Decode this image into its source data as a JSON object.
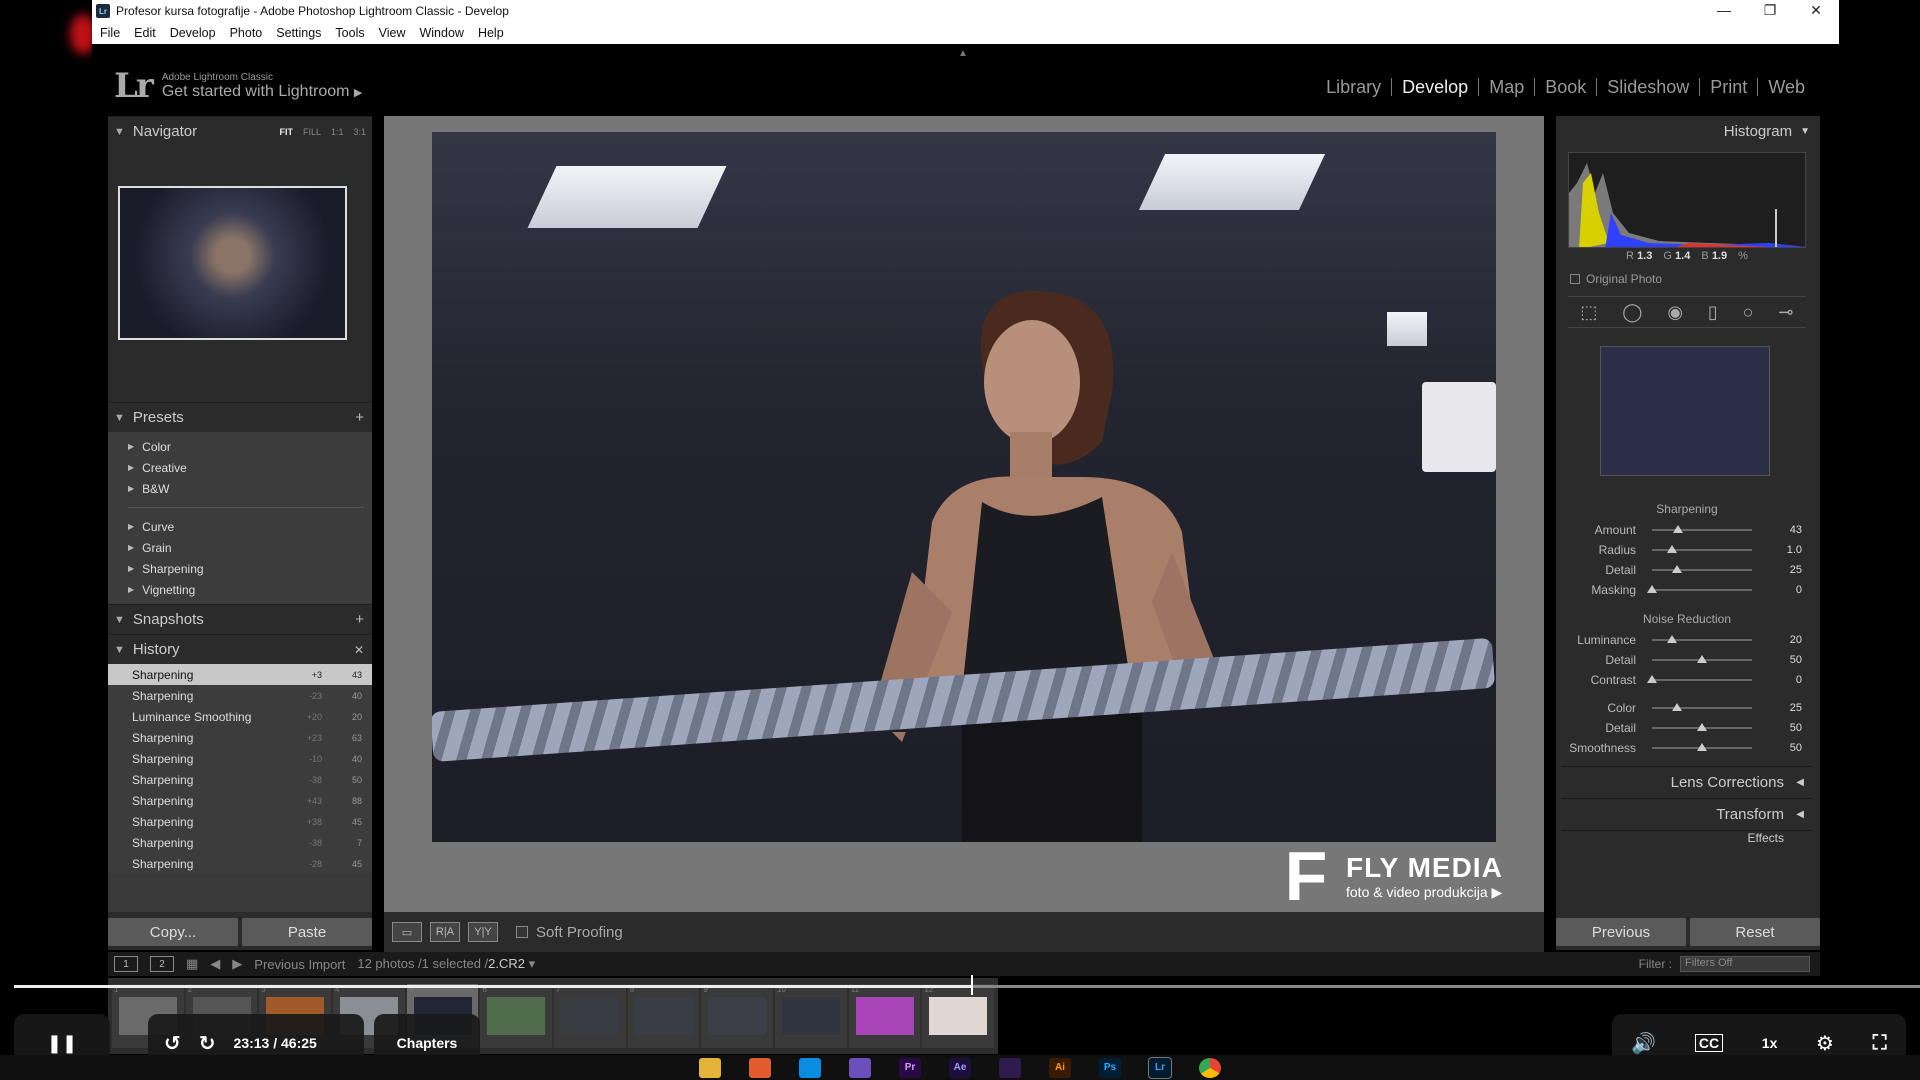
{
  "window": {
    "title": "Profesor kursa fotografije - Adobe Photoshop Lightroom Classic - Develop",
    "app_badge": "Lr",
    "controls": {
      "minimize": "—",
      "maximize": "❐",
      "close": "✕"
    }
  },
  "menubar": [
    "File",
    "Edit",
    "Develop",
    "Photo",
    "Settings",
    "Tools",
    "View",
    "Window",
    "Help"
  ],
  "identity": {
    "logo": "Lr",
    "product": "Adobe Lightroom Classic",
    "tagline": "Get started with Lightroom",
    "tagline_arrow": "▶"
  },
  "modules": [
    "Library",
    "Develop",
    "Map",
    "Book",
    "Slideshow",
    "Print",
    "Web"
  ],
  "active_module": "Develop",
  "navigator": {
    "title": "Navigator",
    "zoom": [
      "FIT",
      "FILL",
      "1:1",
      "3:1"
    ]
  },
  "presets": {
    "title": "Presets",
    "add": "+",
    "groups_a": [
      "Color",
      "Creative",
      "B&W"
    ],
    "groups_b": [
      "Curve",
      "Grain",
      "Sharpening",
      "Vignetting"
    ]
  },
  "snapshots": {
    "title": "Snapshots",
    "add": "+"
  },
  "history": {
    "title": "History",
    "clear": "✕",
    "rows": [
      {
        "name": "Sharpening",
        "delta": "+3",
        "value": "43"
      },
      {
        "name": "Sharpening",
        "delta": "-23",
        "value": "40"
      },
      {
        "name": "Luminance Smoothing",
        "delta": "+20",
        "value": "20"
      },
      {
        "name": "Sharpening",
        "delta": "+23",
        "value": "63"
      },
      {
        "name": "Sharpening",
        "delta": "-10",
        "value": "40"
      },
      {
        "name": "Sharpening",
        "delta": "-38",
        "value": "50"
      },
      {
        "name": "Sharpening",
        "delta": "+43",
        "value": "88"
      },
      {
        "name": "Sharpening",
        "delta": "+38",
        "value": "45"
      },
      {
        "name": "Sharpening",
        "delta": "-38",
        "value": "7"
      },
      {
        "name": "Sharpening",
        "delta": "-28",
        "value": "45"
      }
    ]
  },
  "left_buttons": {
    "copy": "Copy...",
    "paste": "Paste"
  },
  "toolbar": {
    "soft_proofing": "Soft Proofing",
    "view_before_after": "R|A",
    "view_yy": "Y|Y"
  },
  "histogram": {
    "title": "Histogram",
    "r_label": "R",
    "r": "1.3",
    "g_label": "G",
    "g": "1.4",
    "b_label": "B",
    "b": "1.9",
    "unit": "%",
    "original_photo": "Original Photo"
  },
  "sharpening": {
    "title": "Sharpening",
    "sliders": [
      {
        "label": "Amount",
        "value": "43",
        "pos": 0.26
      },
      {
        "label": "Radius",
        "value": "1.0",
        "pos": 0.2
      },
      {
        "label": "Detail",
        "value": "25",
        "pos": 0.25
      },
      {
        "label": "Masking",
        "value": "0",
        "pos": 0.0
      }
    ]
  },
  "noise_reduction": {
    "title": "Noise Reduction",
    "sliders": [
      {
        "label": "Luminance",
        "value": "20",
        "pos": 0.2
      },
      {
        "label": "Detail",
        "value": "50",
        "pos": 0.5
      },
      {
        "label": "Contrast",
        "value": "0",
        "pos": 0.0
      }
    ],
    "color_sliders": [
      {
        "label": "Color",
        "value": "25",
        "pos": 0.25
      },
      {
        "label": "Detail",
        "value": "50",
        "pos": 0.5
      },
      {
        "label": "Smoothness",
        "value": "50",
        "pos": 0.5
      }
    ]
  },
  "collapsed_panels": [
    "Lens Corrections",
    "Transform",
    "Effects"
  ],
  "right_buttons": {
    "previous": "Previous",
    "reset": "Reset"
  },
  "filmstrip": {
    "view1": "1",
    "view2": "2",
    "source": "Previous Import",
    "count": "12 photos /1 selected /",
    "filename": "2.CR2",
    "filter_label": "Filter :",
    "filter_value": "Filters Off",
    "cells": [
      "1",
      "2",
      "3",
      "4",
      "5",
      "6",
      "7",
      "8",
      "9",
      "10",
      "11",
      "12"
    ],
    "selected": 5
  },
  "watermark": {
    "title": "FLY MEDIA",
    "subtitle": "foto & video produkcija"
  },
  "player": {
    "current_time": "23:13",
    "total_time": "/ 46:25",
    "chapters": "Chapters",
    "speed": "1x",
    "progress": 0.502
  },
  "taskbar_apps": [
    "Pr",
    "Ae",
    "Ai",
    "Ps",
    "Lr"
  ]
}
